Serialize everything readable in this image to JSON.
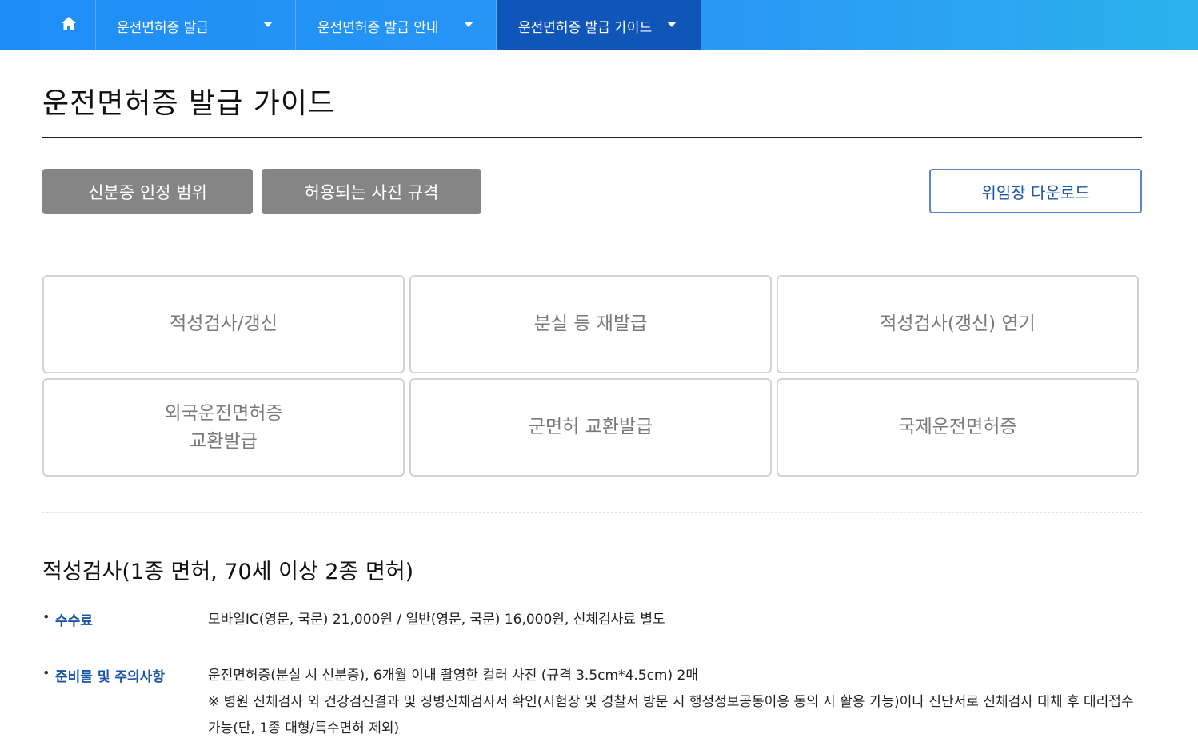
{
  "nav": {
    "home_icon": "home-icon",
    "items": [
      {
        "label": "운전면허증 발급"
      },
      {
        "label": "운전면허증 발급 안내"
      },
      {
        "label": "운전면허증 발급 가이드"
      }
    ],
    "active_color": "#1056b8",
    "bar_color": "#1e8ef7"
  },
  "page": {
    "title": "운전면허증 발급 가이드"
  },
  "actions": {
    "id_scope": "신분증 인정 범위",
    "photo_spec": "허용되는 사진 규격",
    "proxy_download": "위임장 다운로드"
  },
  "cards": [
    {
      "label": "적성검사/갱신"
    },
    {
      "label": "분실 등 재발급"
    },
    {
      "label": "적성검사(갱신) 연기"
    },
    {
      "label": "외국운전면허증\n교환발급"
    },
    {
      "label": "군면허 교환발급"
    },
    {
      "label": "국제운전면허증"
    }
  ],
  "section": {
    "title": "적성검사(1종 면허, 70세 이상 2종 면허)",
    "rows": [
      {
        "label": "수수료",
        "value": "모바일IC(영문, 국문) 21,000원 / 일반(영문, 국문) 16,000원, 신체검사료 별도"
      },
      {
        "label": "준비물 및 주의사항",
        "value": "운전면허증(분실 시 신분증), 6개월 이내 촬영한 컬러 사진 (규격 3.5cm*4.5cm) 2매",
        "note": "※ 병원 신체검사 외 건강검진결과 및 징병신체검사서 확인(시험장 및 경찰서 방문 시 행정정보공동이용 동의 시 활용 가능)이나 진단서로 신체검사 대체 후 대리접수 가능(단, 1종 대형/특수면허 제외)"
      }
    ]
  }
}
